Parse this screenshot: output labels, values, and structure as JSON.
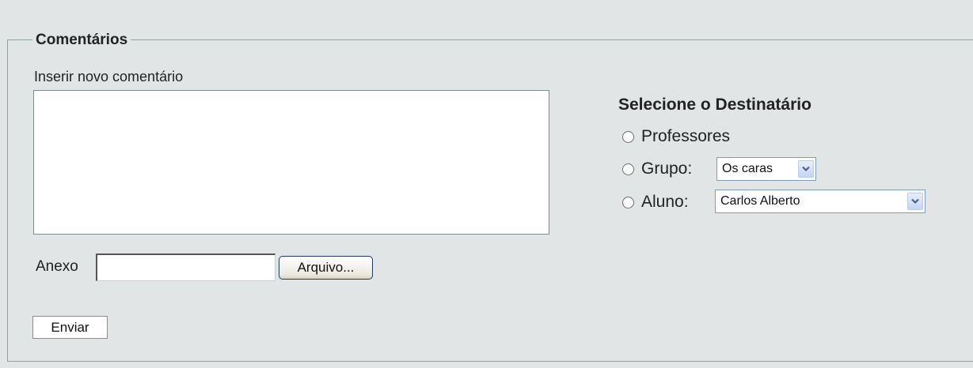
{
  "form": {
    "legend": "Comentários",
    "comment_label": "Inserir novo comentário",
    "comment_value": "",
    "attachment_label": "Anexo",
    "attachment_value": "",
    "browse_button_label": "Arquivo...",
    "submit_button_label": "Enviar"
  },
  "recipient": {
    "title": "Selecione o Destinatário",
    "options": [
      {
        "label": "Professores",
        "selected": false
      },
      {
        "label": "Grupo:",
        "selected": false
      },
      {
        "label": "Aluno:",
        "selected": false
      }
    ],
    "group_select_value": "Os caras",
    "student_select_value": "Carlos Alberto"
  },
  "colors": {
    "background": "#e2e5e5",
    "fieldset_border": "#8fa3a3",
    "select_border": "#7f9db9",
    "dropdown_arrow": "#4d6185"
  },
  "icons": {
    "dropdown": "chevron-down-icon"
  }
}
